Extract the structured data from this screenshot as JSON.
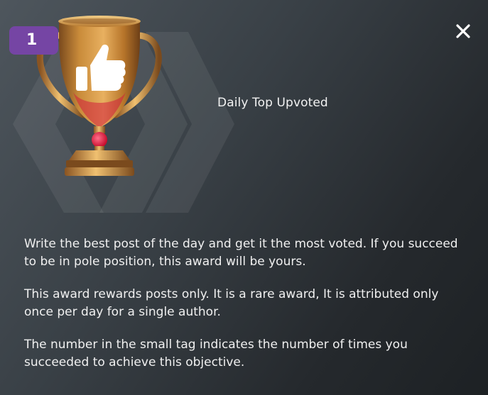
{
  "award": {
    "count": "1",
    "title": "Daily Top Upvoted",
    "paragraphs": [
      "Write the best post of the day and get it the most voted. If you succeed to be in pole position, this award will be yours.",
      "This award rewards posts only. It is a rare award, It is attributed only once per day for a single author.",
      "The number in the small tag indicates the number of times you succeeded to achieve this objective."
    ]
  },
  "icons": {
    "close": "close-icon",
    "trophy": "trophy-thumbs-up-icon",
    "background": "hive-logo-watermark"
  },
  "colors": {
    "tag": "#7545a4",
    "text": "#f0f0f0",
    "gold": "#c88a34",
    "gem": "#e4133a"
  }
}
